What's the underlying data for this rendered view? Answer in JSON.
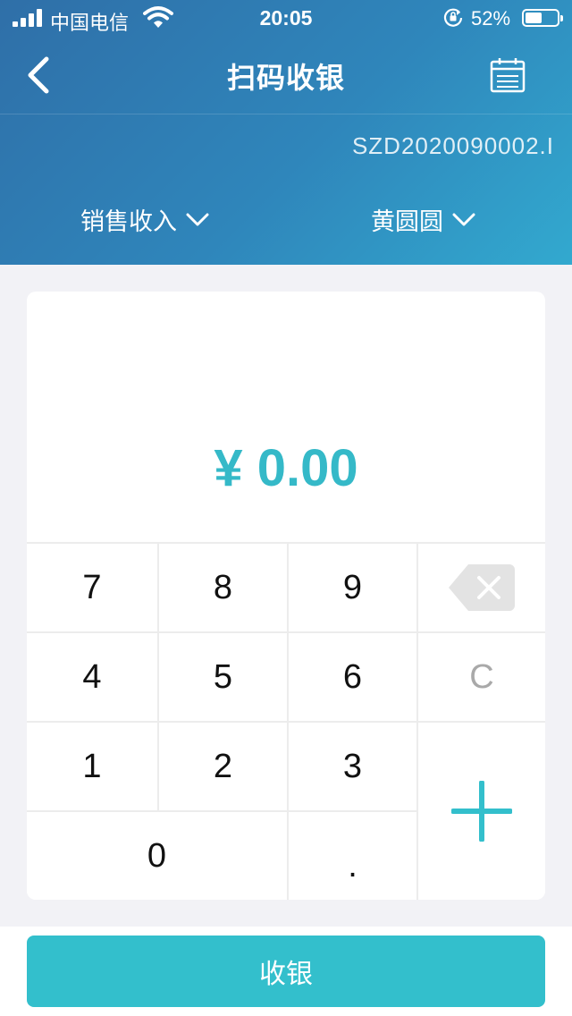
{
  "status_bar": {
    "carrier": "中国电信",
    "time": "20:05",
    "battery_percent": "52%",
    "battery_level": 0.52
  },
  "nav": {
    "title": "扫码收银",
    "back_icon": "chevron-left-icon",
    "right_icon": "calendar-icon"
  },
  "order": {
    "number": "SZD2020090002.I"
  },
  "filters": {
    "category": "销售收入",
    "person": "黄圆圆"
  },
  "amount": {
    "display": "¥ 0.00"
  },
  "keypad": {
    "keys": [
      "7",
      "8",
      "9",
      "4",
      "5",
      "6",
      "1",
      "2",
      "3",
      "0",
      "."
    ],
    "clear": "C",
    "delete_icon": "backspace-icon",
    "plus_icon": "plus-icon"
  },
  "actions": {
    "checkout_label": "收银"
  },
  "colors": {
    "accent": "#33bfcc",
    "amount": "#35b9c8",
    "header_start": "#2f6fa8",
    "header_end": "#32a9cf"
  }
}
